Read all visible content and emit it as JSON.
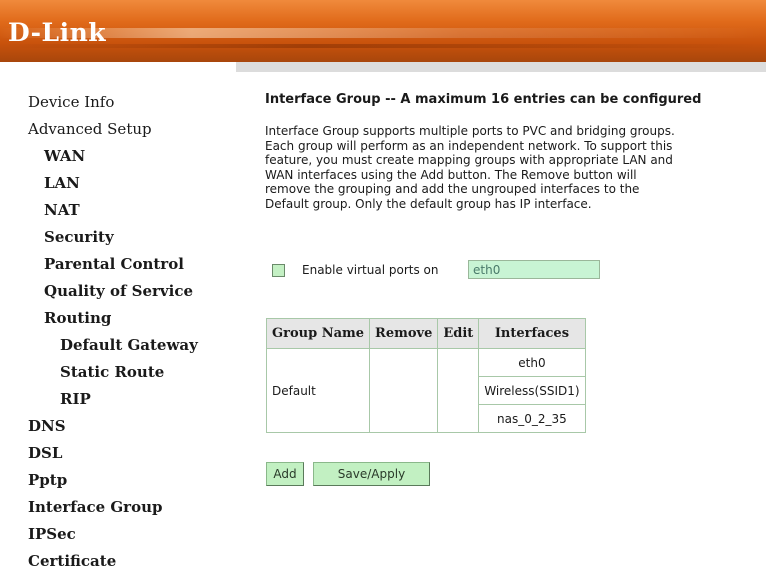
{
  "brand": {
    "logo_text": "D-Link"
  },
  "sidebar": {
    "items": [
      {
        "label": "Device Info",
        "level": 0
      },
      {
        "label": "Advanced Setup",
        "level": 0
      },
      {
        "label": "WAN",
        "level": 1
      },
      {
        "label": "LAN",
        "level": 1
      },
      {
        "label": "NAT",
        "level": 1
      },
      {
        "label": "Security",
        "level": 1
      },
      {
        "label": "Parental Control",
        "level": 1
      },
      {
        "label": "Quality of Service",
        "level": 1
      },
      {
        "label": "Routing",
        "level": 1
      },
      {
        "label": "Default Gateway",
        "level": 2
      },
      {
        "label": "Static Route",
        "level": 2
      },
      {
        "label": "RIP",
        "level": 2
      },
      {
        "label": "DNS",
        "level": 1
      },
      {
        "label": "DSL",
        "level": 1
      },
      {
        "label": "Pptp",
        "level": 1
      },
      {
        "label": "Interface Group",
        "level": 1
      },
      {
        "label": "IPSec",
        "level": 1
      },
      {
        "label": "Certificate",
        "level": 1
      }
    ]
  },
  "main": {
    "title": "Interface Group -- A maximum 16 entries can be configured",
    "description_lines": [
      "Interface Group supports multiple ports to PVC and bridging groups.",
      "Each group will perform as an independent network. To support this",
      "feature, you must create mapping groups with appropriate LAN and",
      "WAN interfaces using the Add button. The Remove button will",
      "remove the grouping and add the ungrouped interfaces to the",
      "Default group. Only the default group has IP interface."
    ],
    "virtual_ports": {
      "label": "Enable virtual ports on",
      "value": "eth0",
      "checked": false
    },
    "table": {
      "headers": [
        "Group Name",
        "Remove",
        "Edit",
        "Interfaces"
      ],
      "rows": [
        {
          "group_name": "Default",
          "remove": "",
          "edit": "",
          "interfaces": [
            "eth0",
            "Wireless(SSID1)",
            "nas_0_2_35"
          ]
        }
      ]
    },
    "buttons": {
      "add": "Add",
      "save_apply": "Save/Apply"
    }
  },
  "colors": {
    "header_orange": "#e06a1a",
    "control_green": "#c2f0c2",
    "input_green": "#c8f4d4",
    "table_header_bg": "#e6e6e6"
  }
}
